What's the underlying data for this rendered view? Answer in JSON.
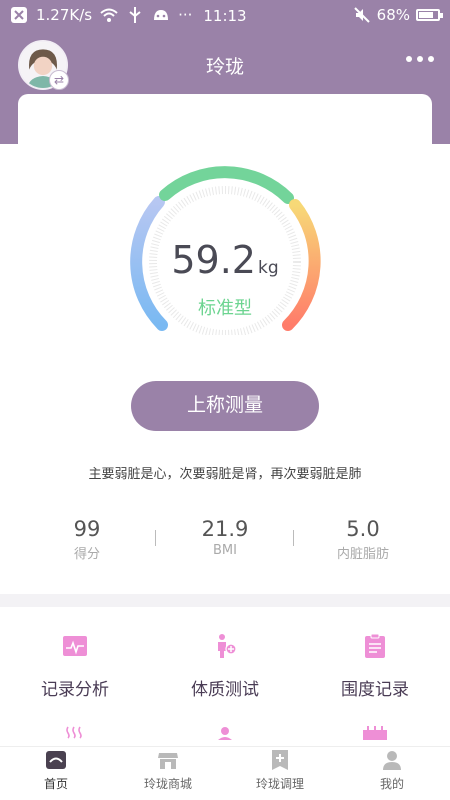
{
  "status_bar": {
    "net_speed": "1.27K/s",
    "dots": "···",
    "time": "11:13",
    "battery": "68%",
    "battery_level": 0.68
  },
  "header": {
    "title": "玲珑",
    "switch_icon": "swap-icon",
    "more_icon": "more-dots-icon"
  },
  "scale": {
    "weight": "59.2",
    "unit": "kg",
    "body_type": "标准型",
    "gauge_colors": [
      "#a7c8f2",
      "#73d49a",
      "#f7d977",
      "#ff8d6a"
    ]
  },
  "measure_button": "上称测量",
  "organ_summary": "主要弱脏是心，次要弱脏是肾，再次要弱脏是肺",
  "stats": [
    {
      "value": "99",
      "label": "得分"
    },
    {
      "value": "21.9",
      "label": "BMI"
    },
    {
      "value": "5.0",
      "label": "内脏脂肪"
    }
  ],
  "functions": [
    {
      "label": "记录分析",
      "icon": "chart-record-icon"
    },
    {
      "label": "体质测试",
      "icon": "constitution-test-icon"
    },
    {
      "label": "围度记录",
      "icon": "clipboard-icon"
    }
  ],
  "tabs": [
    {
      "label": "首页",
      "icon": "home-icon",
      "active": true
    },
    {
      "label": "玲珑商城",
      "icon": "store-icon",
      "active": false
    },
    {
      "label": "玲珑调理",
      "icon": "conditioning-icon",
      "active": false
    },
    {
      "label": "我的",
      "icon": "user-icon",
      "active": false
    }
  ],
  "colors": {
    "brand": "#9a82a8",
    "accent_green": "#6cd490",
    "function_icon": "#ee8fd6"
  }
}
